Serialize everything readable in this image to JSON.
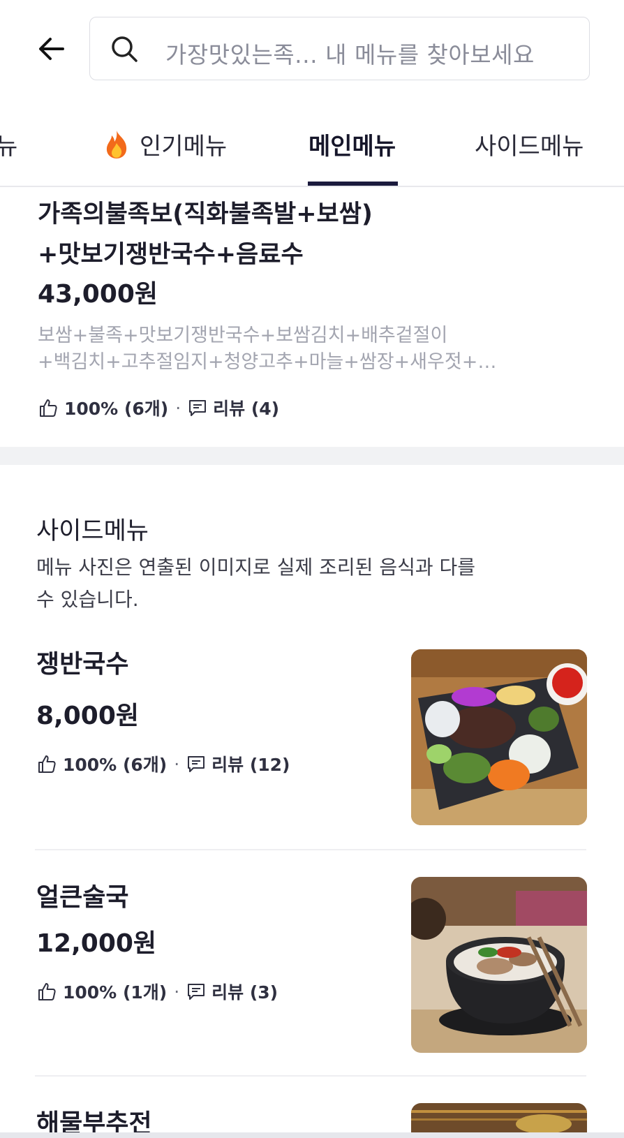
{
  "search": {
    "text": "가장맛있는족...  내 메뉴를 찾아보세요"
  },
  "tabs": [
    {
      "label": "뉴"
    },
    {
      "label": "인기메뉴",
      "icon": "fire-icon"
    },
    {
      "label": "메인메뉴",
      "active": true
    },
    {
      "label": "사이드메뉴"
    }
  ],
  "featured_item": {
    "title_line1": "가족의불족보(직화불족발+보쌈)",
    "title_line2": "+맛보기쟁반국수+음료수",
    "price": "43,000원",
    "desc_line1": "보쌈+불족+맛보기쟁반국수+보쌈김치+배추겉절이",
    "desc_line2": "+백김치+고추절임지+청양고추+마늘+쌈장+새우젓+…",
    "rating": "100% (6개)",
    "reviews": "리뷰 (4)"
  },
  "side_section": {
    "title": "사이드메뉴",
    "note_line1": "메뉴 사진은 연출된 이미지로 실제 조리된 음식과 다를",
    "note_line2": "수 있습니다."
  },
  "menu_items": [
    {
      "name": "쟁반국수",
      "price": "8,000원",
      "rating": "100% (6개)",
      "reviews": "리뷰 (12)"
    },
    {
      "name": "얼큰술국",
      "price": "12,000원",
      "rating": "100% (1개)",
      "reviews": "리뷰 (3)"
    },
    {
      "name": "해물부추전"
    }
  ],
  "colors": {
    "accent": "#1b1a3d",
    "muted": "#a3a5b0",
    "band": "#f1f2f4"
  }
}
